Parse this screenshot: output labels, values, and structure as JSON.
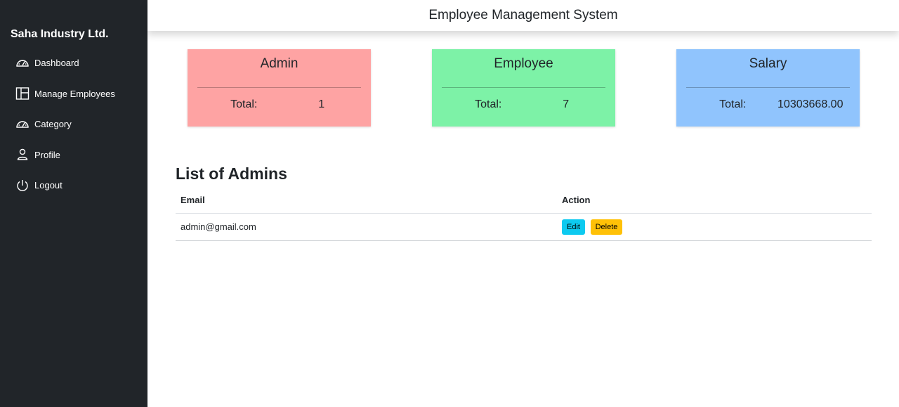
{
  "sidebar": {
    "brand": "Saha Industry Ltd.",
    "items": [
      {
        "label": "Dashboard",
        "icon": "speedometer-icon"
      },
      {
        "label": "Manage Employees",
        "icon": "columns-icon"
      },
      {
        "label": "Category",
        "icon": "speedometer-icon"
      },
      {
        "label": "Profile",
        "icon": "person-icon"
      },
      {
        "label": "Logout",
        "icon": "power-icon"
      }
    ]
  },
  "header": {
    "title": "Employee Management System"
  },
  "cards": {
    "admin": {
      "title": "Admin",
      "total_label": "Total:",
      "total_value": "1",
      "color": "#fea3a3"
    },
    "employee": {
      "title": "Employee",
      "total_label": "Total:",
      "total_value": "7",
      "color": "#7df2a7"
    },
    "salary": {
      "title": "Salary",
      "total_label": "Total:",
      "total_value": "10303668.00",
      "color": "#90c4fd"
    }
  },
  "admins": {
    "title": "List of Admins",
    "columns": [
      "Email",
      "Action"
    ],
    "rows": [
      {
        "email": "admin@gmail.com",
        "edit_label": "Edit",
        "delete_label": "Delete"
      }
    ]
  },
  "colors": {
    "sidebar_bg": "#212529",
    "edit": "#0dcaf0",
    "delete": "#ffc107"
  }
}
